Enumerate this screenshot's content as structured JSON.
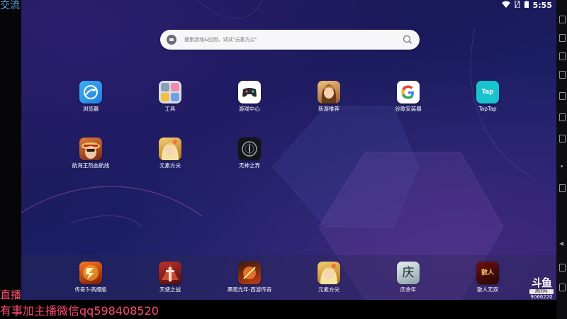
{
  "overlays": {
    "top_left": "交流",
    "live": "直播",
    "contact": "有事加主播微信qq598408520"
  },
  "status_bar": {
    "time": "5:55"
  },
  "search": {
    "placeholder": "搜索游戏&应用，试试\"元素方尖\""
  },
  "apps_row1": [
    {
      "label": "浏览器",
      "icon": "browser-icon"
    },
    {
      "label": "工具",
      "icon": "tools-folder-icon"
    },
    {
      "label": "游戏中心",
      "icon": "game-center-icon"
    },
    {
      "label": "新游推荐",
      "icon": "new-games-icon"
    },
    {
      "label": "谷歌安装器",
      "icon": "google-installer-icon"
    },
    {
      "label": "TapTap",
      "icon": "taptap-icon",
      "icon_text": "Tap"
    }
  ],
  "apps_row2": [
    {
      "label": "航海王热血航线",
      "icon": "one-piece-icon"
    },
    {
      "label": "元素方尖",
      "icon": "element-spire-icon"
    },
    {
      "label": "无神之界",
      "icon": "godless-world-icon"
    }
  ],
  "dock": [
    {
      "label": "传奇3-高爆版",
      "icon": "legend3-icon"
    },
    {
      "label": "天使之战",
      "icon": "angel-war-icon"
    },
    {
      "label": "黑暗光年-西游传奇",
      "icon": "dark-lightyear-icon"
    },
    {
      "label": "元素方尖",
      "icon": "element-spire-icon"
    },
    {
      "label": "庆余年",
      "icon": "qingyunian-icon",
      "icon_text": "庆"
    },
    {
      "label": "散人无双",
      "icon": "sanren-wushuang-icon",
      "icon_text": "散人"
    }
  ],
  "watermark": {
    "logo": "斗鱼",
    "sub": "房间号",
    "room": "9066220"
  },
  "colors": {
    "overlay_blue": "#5aa7e8",
    "overlay_pink": "#ff4a72",
    "background": "#1c1c5e"
  }
}
